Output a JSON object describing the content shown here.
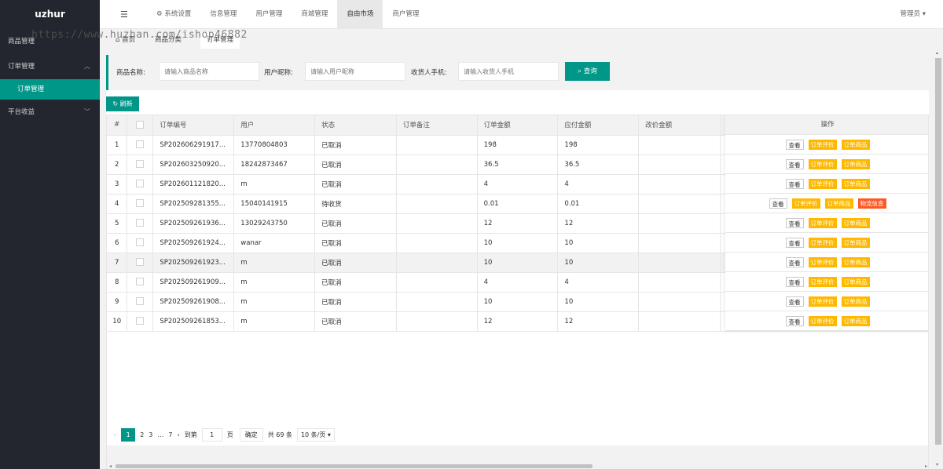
{
  "logo": "uzhur",
  "sidebar": {
    "item_goods": "商品管理",
    "item_order": "订单管理",
    "item_order_sub": "订单管理",
    "item_income": "平台收益"
  },
  "topnav": {
    "items": [
      {
        "label": "⚙ 系统设置"
      },
      {
        "label": "信息管理"
      },
      {
        "label": "用户管理"
      },
      {
        "label": "商城管理"
      },
      {
        "label": "自由市场"
      },
      {
        "label": "商户管理"
      }
    ],
    "active_index": 4,
    "admin": "管理员 ▾"
  },
  "tabs": {
    "home": "首页",
    "category": "商品分类",
    "order": "订单管理"
  },
  "watermark": "https://www.huzhan.com/ishop46882",
  "search": {
    "goods_label": "商品名称:",
    "goods_placeholder": "请输入商品名称",
    "nick_label": "用户昵称:",
    "nick_placeholder": "请输入用户昵称",
    "phone_label": "收货人手机:",
    "phone_placeholder": "请输入收货人手机",
    "button": "查询"
  },
  "refresh_label": "刷新",
  "table": {
    "headers": {
      "no": "#",
      "order_no": "订单编号",
      "user": "用户",
      "status": "状态",
      "remark": "订单备注",
      "amount": "订单金额",
      "payable": "应付金额",
      "changed": "改价金额",
      "ops": "操作"
    },
    "rows": [
      {
        "no": "1",
        "order_no": "SP202606291917...",
        "user": "13770804803",
        "status": "已取消",
        "remark": "",
        "amount": "198",
        "payable": "198",
        "changed": "",
        "logistics": false
      },
      {
        "no": "2",
        "order_no": "SP202603250920...",
        "user": "18242873467",
        "status": "已取消",
        "remark": "",
        "amount": "36.5",
        "payable": "36.5",
        "changed": "",
        "logistics": false
      },
      {
        "no": "3",
        "order_no": "SP202601121820...",
        "user": "m",
        "status": "已取消",
        "remark": "",
        "amount": "4",
        "payable": "4",
        "changed": "",
        "logistics": false
      },
      {
        "no": "4",
        "order_no": "SP202509281355...",
        "user": "15040141915",
        "status": "待收货",
        "remark": "",
        "amount": "0.01",
        "payable": "0.01",
        "changed": "",
        "logistics": true
      },
      {
        "no": "5",
        "order_no": "SP202509261936...",
        "user": "13029243750",
        "status": "已取消",
        "remark": "",
        "amount": "12",
        "payable": "12",
        "changed": "",
        "logistics": false
      },
      {
        "no": "6",
        "order_no": "SP202509261924...",
        "user": "wanar",
        "status": "已取消",
        "remark": "",
        "amount": "10",
        "payable": "10",
        "changed": "",
        "logistics": false
      },
      {
        "no": "7",
        "order_no": "SP202509261923...",
        "user": "m",
        "status": "已取消",
        "remark": "",
        "amount": "10",
        "payable": "10",
        "changed": "",
        "logistics": false
      },
      {
        "no": "8",
        "order_no": "SP202509261909...",
        "user": "m",
        "status": "已取消",
        "remark": "",
        "amount": "4",
        "payable": "4",
        "changed": "",
        "logistics": false
      },
      {
        "no": "9",
        "order_no": "SP202509261908...",
        "user": "m",
        "status": "已取消",
        "remark": "",
        "amount": "10",
        "payable": "10",
        "changed": "",
        "logistics": false
      },
      {
        "no": "10",
        "order_no": "SP202509261853...",
        "user": "m",
        "status": "已取消",
        "remark": "",
        "amount": "12",
        "payable": "12",
        "changed": "",
        "logistics": false
      }
    ],
    "highlight_index": 6,
    "actions": {
      "view": "查看",
      "review": "订单评价",
      "goods": "订单商品",
      "logistics": "物流信息"
    }
  },
  "pager": {
    "prev": "‹",
    "pages": [
      "1",
      "2",
      "3"
    ],
    "current": "1",
    "ellipsis": "…",
    "last": "7",
    "next": "›",
    "goto_label": "到第",
    "goto_value": "1",
    "page_unit": "页",
    "confirm": "确定",
    "total": "共 69 条",
    "per_page": "10 条/页 ▾"
  },
  "colors": {
    "primary": "#009688",
    "warn": "#ffb800",
    "danger": "#ff5722",
    "sidebar": "#23262e"
  }
}
